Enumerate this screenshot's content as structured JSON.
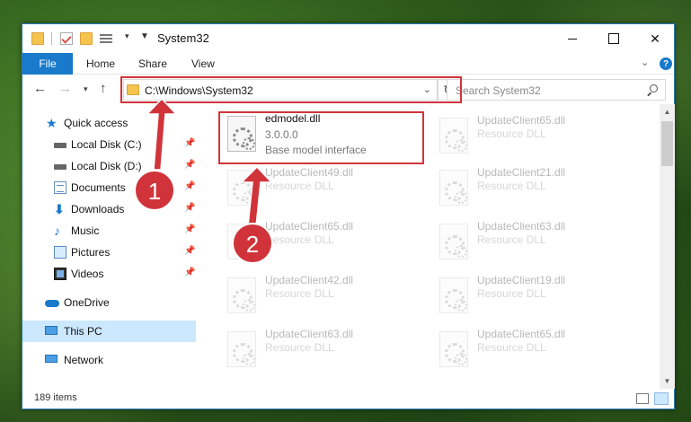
{
  "window": {
    "title": "System32",
    "accent_color": "#1979ca",
    "annotation_color": "#d0343a"
  },
  "controls": {
    "close_glyph": "✕"
  },
  "ribbon": {
    "file": "File",
    "home": "Home",
    "share": "Share",
    "view": "View"
  },
  "navigation": {
    "address": "C:\\Windows\\System32",
    "search_placeholder": "Search System32"
  },
  "sidebar": {
    "items": [
      {
        "label": "Quick access",
        "icon": "star-icon"
      },
      {
        "label": "Local Disk (C:)",
        "icon": "disk-icon",
        "pinned": true
      },
      {
        "label": "Local Disk (D:)",
        "icon": "disk-icon",
        "pinned": true
      },
      {
        "label": "Documents",
        "icon": "documents-icon",
        "pinned": true
      },
      {
        "label": "Downloads",
        "icon": "download-icon",
        "pinned": true
      },
      {
        "label": "Music",
        "icon": "music-icon",
        "pinned": true
      },
      {
        "label": "Pictures",
        "icon": "pictures-icon",
        "pinned": true
      },
      {
        "label": "Videos",
        "icon": "videos-icon",
        "pinned": true
      },
      {
        "label": "OneDrive",
        "icon": "cloud-icon"
      },
      {
        "label": "This PC",
        "icon": "pc-icon",
        "selected": true
      },
      {
        "label": "Network",
        "icon": "network-icon"
      }
    ]
  },
  "files": [
    {
      "name": "edmodel.dll",
      "version": "3.0.0.0",
      "description": "Base model interface",
      "highlighted": true
    },
    {
      "name": "UpdateClient65.dll",
      "description": "Resource DLL"
    },
    {
      "name": "UpdateClient49.dll",
      "description": "Resource DLL"
    },
    {
      "name": "UpdateClient21.dll",
      "description": "Resource DLL"
    },
    {
      "name": "UpdateClient65.dll",
      "description": "Resource DLL"
    },
    {
      "name": "UpdateClient63.dll",
      "description": "Resource DLL"
    },
    {
      "name": "UpdateClient42.dll",
      "description": "Resource DLL"
    },
    {
      "name": "UpdateClient19.dll",
      "description": "Resource DLL"
    },
    {
      "name": "UpdateClient63.dll",
      "description": "Resource DLL"
    },
    {
      "name": "UpdateClient65.dll",
      "description": "Resource DLL"
    }
  ],
  "status": {
    "item_count": "189 items"
  },
  "annotations": [
    {
      "number": "1"
    },
    {
      "number": "2"
    }
  ]
}
